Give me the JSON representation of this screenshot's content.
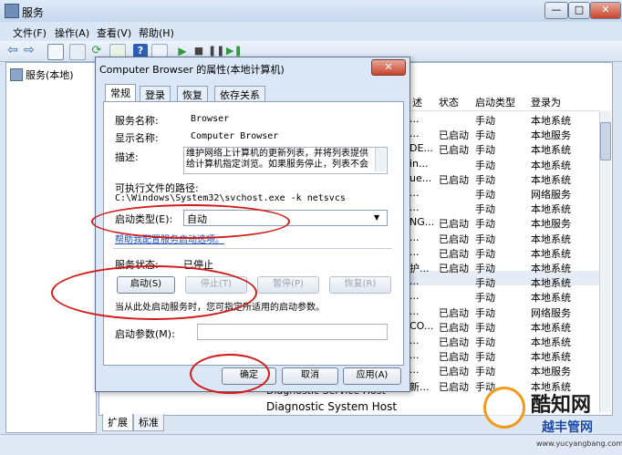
{
  "window": {
    "title": "服务",
    "min": "—",
    "max": "□",
    "close": "✕"
  },
  "menu": [
    "文件(F)",
    "操作(A)",
    "查看(V)",
    "帮助(H)"
  ],
  "left_pane": {
    "item": "服务(本地)"
  },
  "columns": {
    "desc": "述",
    "status": "状态",
    "startup": "启动类型",
    "logon": "登录为"
  },
  "rows": [
    {
      "d": "...",
      "s": "",
      "t": "手动",
      "l": "本地系统"
    },
    {
      "d": "...",
      "s": "已启动",
      "t": "手动",
      "l": "本地服务"
    },
    {
      "d": "DE...",
      "s": "已启动",
      "t": "手动",
      "l": "本地系统"
    },
    {
      "d": "in...",
      "s": "",
      "t": "手动",
      "l": "本地系统"
    },
    {
      "d": "ue...",
      "s": "已启动",
      "t": "手动",
      "l": "本地系统"
    },
    {
      "d": "...",
      "s": "",
      "t": "手动",
      "l": "网络服务"
    },
    {
      "d": "...",
      "s": "",
      "t": "手动",
      "l": "本地系统"
    },
    {
      "d": "NG...",
      "s": "已启动",
      "t": "手动",
      "l": "本地服务"
    },
    {
      "d": "...",
      "s": "已启动",
      "t": "手动",
      "l": "本地系统"
    },
    {
      "d": "...",
      "s": "已启动",
      "t": "手动",
      "l": "本地系统"
    },
    {
      "d": "护...",
      "s": "已启动",
      "t": "手动",
      "l": "本地系统"
    },
    {
      "d": "...",
      "s": "",
      "t": "手动",
      "l": "本地系统"
    },
    {
      "d": "...",
      "s": "",
      "t": "手动",
      "l": "本地系统"
    },
    {
      "d": "...",
      "s": "已启动",
      "t": "手动",
      "l": "网络服务"
    },
    {
      "d": "CO...",
      "s": "已启动",
      "t": "手动",
      "l": "本地系统"
    },
    {
      "d": "...",
      "s": "已启动",
      "t": "手动",
      "l": "本地系统"
    },
    {
      "d": "...",
      "s": "已启动",
      "t": "手动",
      "l": "本地系统"
    },
    {
      "d": "...",
      "s": "已启动",
      "t": "手动",
      "l": "本地服务"
    },
    {
      "d": "新...",
      "s": "已启动",
      "t": "手动",
      "l": "本地系统"
    }
  ],
  "service_rows": [
    "Diagnostic Service Host",
    "Diagnostic System Host"
  ],
  "bottom_tabs": [
    "扩展",
    "标准"
  ],
  "dialog": {
    "title": "Computer Browser 的属性(本地计算机)",
    "close": "✕",
    "tabs": [
      "常规",
      "登录",
      "恢复",
      "依存关系"
    ],
    "service_name_label": "服务名称:",
    "service_name": "Browser",
    "display_name_label": "显示名称:",
    "display_name": "Computer Browser",
    "desc_label": "描述:",
    "desc": "维护网络上计算机的更新列表，并将列表提供给计算机指定浏览。如果服务停止，列表不会",
    "path_label": "可执行文件的路径:",
    "path": "C:\\Windows\\System32\\svchost.exe -k netsvcs",
    "startup_label": "启动类型(E):",
    "startup_value": "自动",
    "help_link": "帮助我配置服务启动选项。",
    "status_label": "服务状态:",
    "status_value": "已停止",
    "btn_start": "启动(S)",
    "btn_stop": "停止(T)",
    "btn_pause": "暂停(P)",
    "btn_resume": "恢复(R)",
    "hint": "当从此处启动服务时，您可指定所适用的启动参数。",
    "params_label": "启动参数(M):",
    "params_value": "",
    "ok": "确定",
    "cancel": "取消",
    "apply": "应用(A)"
  },
  "watermark": {
    "brand": "酷知网",
    "site": "www.yucyangbang.com",
    "brand2": "越丰管网"
  }
}
